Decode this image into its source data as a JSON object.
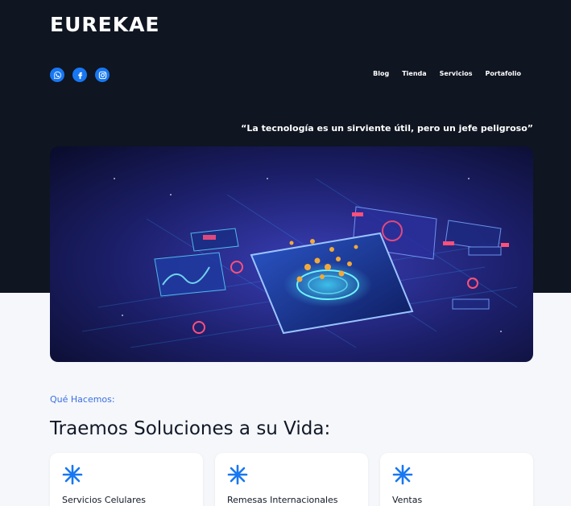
{
  "brand": {
    "name": "EUREKAE"
  },
  "header": {
    "socials": [
      {
        "icon": "whatsapp-icon"
      },
      {
        "icon": "facebook-icon"
      },
      {
        "icon": "instagram-icon"
      }
    ],
    "nav": [
      "Blog",
      "Tienda",
      "Servicios",
      "Portafolio"
    ]
  },
  "hero": {
    "quote": "“La tecnología es un sirviente útil, pero un jefe peligroso”",
    "image_icon": "smartphone-technology-illustration"
  },
  "services": {
    "kicker": "Qué Hacemos:",
    "title": "Traemos Soluciones a su Vida:",
    "items": [
      {
        "icon": "asterisk-icon",
        "label": "Servicios Celulares"
      },
      {
        "icon": "asterisk-icon",
        "label": "Remesas Internacionales"
      },
      {
        "icon": "asterisk-icon",
        "label": "Ventas"
      }
    ]
  },
  "colors": {
    "header_bg": "#0f1521",
    "accent": "#1877f2",
    "page_bg": "#f5f7fb"
  }
}
